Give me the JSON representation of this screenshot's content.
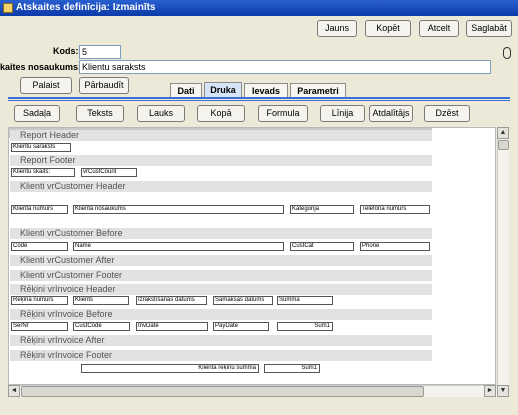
{
  "window": {
    "title": "Atskaites definīcija: Izmainīts"
  },
  "toolbar": {
    "new": "Jauns",
    "copy": "Kopēt",
    "cancel": "Atcelt",
    "save": "Saglabāt"
  },
  "form": {
    "code_label": "Kods:",
    "code_value": "5",
    "name_label": "kaites nosaukums:",
    "name_value": "Klientu saraksts"
  },
  "actions": {
    "help": "Palaist",
    "check": "Pārbaudīt"
  },
  "tabs": [
    "Dati",
    "Druka",
    "Ievads",
    "Parametri"
  ],
  "active_tab": "Druka",
  "design_buttons": [
    "Sadaļa",
    "Teksts",
    "Lauks",
    "Kopā",
    "Formula",
    "Līnija",
    "Atdalītājs",
    "Dzēst"
  ],
  "report": {
    "sections": [
      "Report Header",
      "Report Footer",
      "Klienti vrCustomer Header",
      "Klienti vrCustomer Before",
      "Klienti vrCustomer After",
      "Klienti vrCustomer Footer",
      "Rēķini vrInvoice Header",
      "Rēķini vrInvoice Before",
      "Rēķini vrInvoice After",
      "Rēķini vrInvoice Footer"
    ],
    "fields": {
      "report_header": [
        "Klientu saraksts"
      ],
      "report_footer": [
        "Klientu skaits:",
        "vrCustCount"
      ],
      "customer_header": [
        "Klienta numurs",
        "Klienta nosaukums",
        "Kategorija",
        "Telefona numurs"
      ],
      "customer_before": [
        "Code",
        "Name",
        "CustCat",
        "Phone"
      ],
      "invoice_header": [
        "Rēķina numurs",
        "Klients",
        "Izrakstīšanas datums",
        "Samaksas datums",
        "Summa"
      ],
      "invoice_before": [
        "SerNr",
        "CustCode",
        "InvDate",
        "PayDate",
        "Sum1"
      ],
      "invoice_footer": [
        "Klienta rēķinu summa",
        "Sum1"
      ]
    }
  },
  "scrollbar": {
    "up": "▲",
    "down": "▼",
    "left": "◄",
    "right": "►"
  }
}
